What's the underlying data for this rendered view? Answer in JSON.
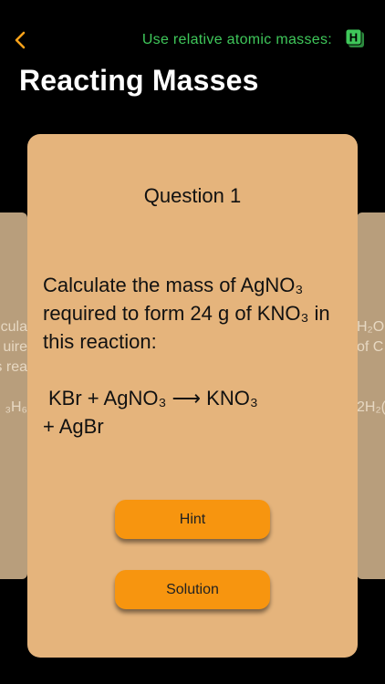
{
  "header": {
    "back_icon": "chevron-left-icon",
    "ram_label": "Use relative atomic masses:",
    "ram_badge_letter": "H",
    "accent": "#3fc75a"
  },
  "page": {
    "title": "Reacting Masses"
  },
  "background_cards": {
    "left": {
      "line1": "cula",
      "line2": "uire",
      "line3": "s rea",
      "line4": "₃H₆"
    },
    "right": {
      "line1": "H₂O",
      "line2": "of C",
      "line3": "2H₂("
    }
  },
  "card": {
    "question_number": "Question 1",
    "question_text": "Calculate the mass of AgNO₃ required to form 24 g of KNO₃ in this reaction:",
    "equation_line1": "KBr +  AgNO₃ ⟶  KNO₃",
    "equation_line2": "+  AgBr",
    "hint_label": "Hint",
    "solution_label": "Solution"
  },
  "colors": {
    "card": "#e5b47c",
    "button": "#f7950f",
    "background": "#000000"
  }
}
